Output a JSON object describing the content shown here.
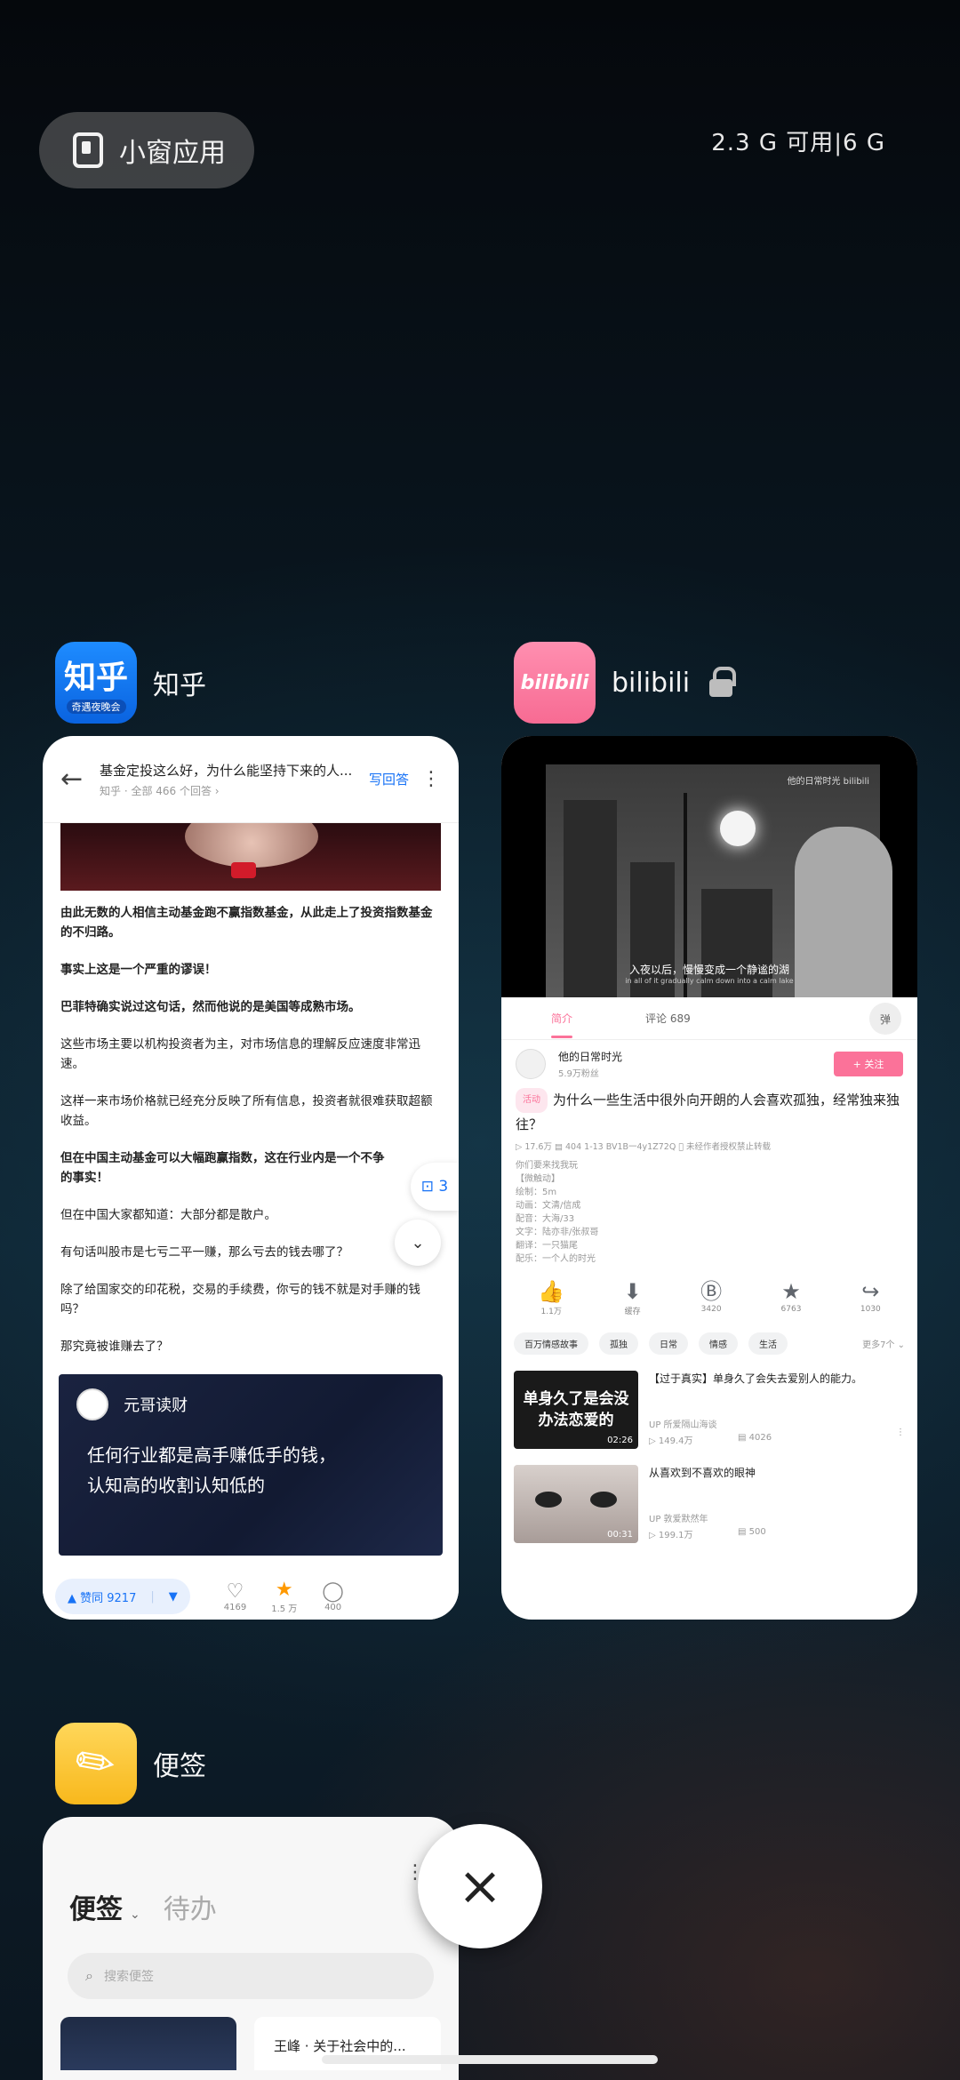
{
  "top": {
    "floating_button_label": "小窗应用",
    "memory_status": "2.3 G 可用|6 G"
  },
  "apps": {
    "zhihu": {
      "name": "知乎",
      "icon_text": "知乎",
      "icon_subtext": "奇遇夜晚会",
      "header_title": "基金定投这么好，为什么能坚持下来的人...",
      "header_sub": "知乎 · 全部 466 个回答 ›",
      "write_answer": "写回答",
      "paragraphs": [
        "由此无数的人相信主动基金跑不赢指数基金，从此走上了投资指数基金的不归路。",
        "事实上这是一个严重的谬误！",
        "巴菲特确实说过这句话，然而他说的是美国等成熟市场。",
        "这些市场主要以机构投资者为主，对市场信息的理解反应速度非常迅速。",
        "这样一来市场价格就已经充分反映了所有信息，投资者就很难获取超额收益。",
        "但在中国主动基金可以大幅跑赢指数，这在行业内是一个不争的事实！",
        "但在中国大家都知道：大部分都是散户。",
        "有句话叫股市是七亏二平一赚，那么亏去的钱去哪了？",
        "除了给国家交的印花税，交易的手续费，你亏的钱不就是对手赚的钱吗？",
        "那究竟被谁赚去了？"
      ],
      "float_count": "3",
      "quote_card": {
        "author": "元哥读财",
        "line1": "任何行业都是高手赚低手的钱，",
        "line2": "认知高的收割认知低的"
      },
      "vote_label": "▲ 赞同 9217",
      "vote_down": "▼",
      "actions": [
        {
          "icon": "♡",
          "label": "4169"
        },
        {
          "icon": "★",
          "label": "1.5 万"
        },
        {
          "icon": "◯",
          "label": "400"
        }
      ]
    },
    "bilibili": {
      "name": "bilibili",
      "icon_text": "bilibili",
      "video_logo": "他的日常时光 bilibili",
      "subtitle_cn": "入夜以后，慢慢变成一个静谧的湖",
      "subtitle_en": "in all of it gradually calm down into a calm lake",
      "tab_intro": "简介",
      "tab_comments": "评论 689",
      "danmu": "弹",
      "uploader": "他的日常时光",
      "fans": "5.9万粉丝",
      "follow": "+ 关注",
      "tag": "活动",
      "title": "为什么一些生活中很外向开朗的人会喜欢孤独，经常独来独往？",
      "stats": "▷ 17.6万   ▤ 404   1-13   BV1B一4y1Z72Q   ⃠ 未经作者授权禁止转载",
      "desc": [
        "你们要来找我玩",
        "【微触动】",
        "绘制：5m",
        "动画：文清/信成",
        "配音：大海/33",
        "文字：陆亦非/张叔哥",
        "翻译：一只猫尾",
        "配乐：一个人的时光"
      ],
      "actions": [
        {
          "icon": "👍",
          "label": "1.1万"
        },
        {
          "icon": "⬇",
          "label": "缓存"
        },
        {
          "icon": "Ⓑ",
          "label": "3420"
        },
        {
          "icon": "★",
          "label": "6763"
        },
        {
          "icon": "↪",
          "label": "1030"
        }
      ],
      "chips": [
        "百万情感故事",
        "孤独",
        "日常",
        "情感",
        "生活"
      ],
      "chips_more": "更多7个 ⌄",
      "recs": [
        {
          "thumb_text": "单身久了是会没办法恋爱的",
          "duration": "02:26",
          "title": "【过于真实】单身久了会失去爱别人的能力。",
          "up": "UP 所爱隔山海谈",
          "views": "▷ 149.4万",
          "danmu": "▤ 4026"
        },
        {
          "thumb_text": "",
          "duration": "00:31",
          "title": "从喜欢到不喜欢的眼神",
          "up": "UP 敦爱默然年",
          "views": "▷ 199.1万",
          "danmu": "▤ 500"
        }
      ]
    },
    "notes": {
      "name": "便签",
      "title": "便签",
      "title2": "待办",
      "search_placeholder": "搜索便签",
      "note_title": "王峰 · 关于社会中的..."
    }
  },
  "close_label": "×"
}
